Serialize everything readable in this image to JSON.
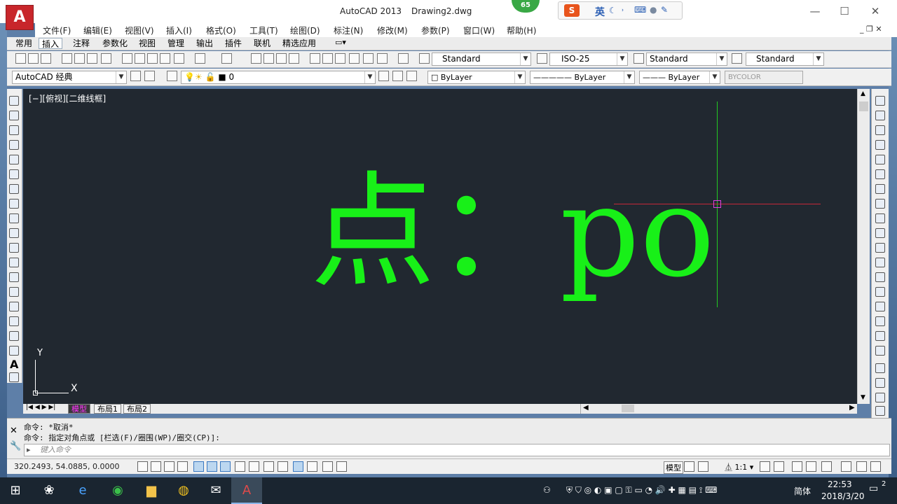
{
  "window": {
    "app_name": "AutoCAD 2013",
    "doc_name": "Drawing2.dwg",
    "app_logo": "A",
    "badge": "65",
    "min": "—",
    "max": "☐",
    "close": "✕"
  },
  "ime": {
    "lang": "英",
    "logo": "S"
  },
  "menu": [
    "文件(F)",
    "编辑(E)",
    "视图(V)",
    "插入(I)",
    "格式(O)",
    "工具(T)",
    "绘图(D)",
    "标注(N)",
    "修改(M)",
    "参数(P)",
    "窗口(W)",
    "帮助(H)"
  ],
  "ribbon_tabs": [
    "常用",
    "插入",
    "注释",
    "参数化",
    "视图",
    "管理",
    "输出",
    "插件",
    "联机",
    "精选应用"
  ],
  "toolbar": {
    "text_style": "Standard",
    "dim_style": "ISO-25",
    "table_style": "Standard",
    "mleader_style": "Standard",
    "workspace": "AutoCAD 经典",
    "layer": "0",
    "color": "ByLayer",
    "linetype": "ByLayer",
    "lineweight": "ByLayer",
    "plotstyle": "BYCOLOR"
  },
  "canvas": {
    "view_label": "[−][俯视][二维线框]",
    "big_text": "点：po",
    "ucs_x": "X",
    "ucs_y": "Y",
    "text_color": "#18f018",
    "bg_color": "#212830"
  },
  "layout_tabs": [
    "模型",
    "布局1",
    "布局2"
  ],
  "command": {
    "line1": "命令: *取消*",
    "line2": "命令: 指定对角点或 [栏选(F)/圈围(WP)/圈交(CP)]:",
    "placeholder": "键入命令"
  },
  "status": {
    "coords": "320.2493, 54.0885, 0.0000",
    "model": "模型",
    "scale": "1:1"
  },
  "tray": {
    "lang": "简体",
    "time": "22:53",
    "date": "2018/3/20",
    "notif": "2"
  }
}
